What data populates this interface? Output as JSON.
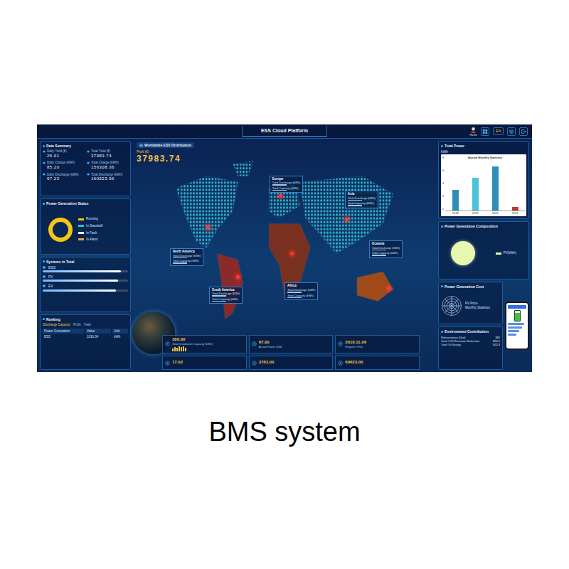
{
  "caption": "BMS system",
  "dashboard": {
    "title": "ESS Cloud Platform",
    "header": {
      "home": "Home",
      "language": "EN"
    },
    "data_summary": {
      "title": "Data Summary",
      "items": [
        {
          "label": "Daily Yield (€)",
          "value": "25.01"
        },
        {
          "label": "Total Yield (€)",
          "value": "37983.74"
        },
        {
          "label": "Daily Charge (kWh)",
          "value": "85.20"
        },
        {
          "label": "Total Charge (kWh)",
          "value": "156308.36"
        },
        {
          "label": "Daily Discharge (kWh)",
          "value": "67.23"
        },
        {
          "label": "Total Discharge (kWh)",
          "value": "160523.66"
        }
      ]
    },
    "status": {
      "title": "Power Generation Status",
      "legend": [
        {
          "label": "Running",
          "color": "#f5c518",
          "share": 1
        },
        {
          "label": "In Standstill",
          "color": "#22c1d6",
          "share": 0
        },
        {
          "label": "In Fault",
          "color": "#ffffff",
          "share": 0
        },
        {
          "label": "In Alarm",
          "color": "#e8a33a",
          "share": 0
        }
      ]
    },
    "systems": {
      "title": "Systems in Total",
      "items": [
        {
          "label": "ESS",
          "level": 0.92
        },
        {
          "label": "PV",
          "level": 0.88
        },
        {
          "label": "EV",
          "level": 0.86
        }
      ]
    },
    "ranking": {
      "title": "Ranking",
      "tabs": [
        {
          "label": "Discharge Capacity",
          "selected": true
        },
        {
          "label": "Profit",
          "selected": false
        },
        {
          "label": "Yield",
          "selected": false
        }
      ],
      "columns": [
        "Power Generation",
        "Value",
        "Unit"
      ],
      "rows": [
        [
          "ESS",
          "1016.34",
          "kWh"
        ]
      ]
    },
    "map": {
      "title": "Worldwide ESS Distribution",
      "profit_label": "Profit (€):",
      "profit": "37983.74",
      "regions": [
        {
          "name": "Europe",
          "lines": [
            "Total Discharge (kWh)",
            "Total Capacity (kWh)"
          ]
        },
        {
          "name": "Asia",
          "lines": [
            "Total Discharge (kWh)",
            "Total Capacity (kWh)"
          ]
        },
        {
          "name": "North America",
          "lines": [
            "Total Discharge (kWh)",
            "Total Capacity (kWh)"
          ]
        },
        {
          "name": "South America",
          "lines": [
            "Total Discharge (kWh)",
            "Total Capacity (kWh)"
          ]
        },
        {
          "name": "Africa",
          "lines": [
            "Total Discharge (kWh)",
            "Total Capacity (kWh)"
          ]
        },
        {
          "name": "Oceania",
          "lines": [
            "Total Discharge (kWh)",
            "Total Capacity (kWh)"
          ]
        }
      ]
    },
    "stats": [
      {
        "value": "300.00",
        "label": "Total Installation Capacity (kWh)"
      },
      {
        "value": "67.00",
        "label": "Actual Power (kW)"
      },
      {
        "value": "2019.11.06",
        "label": "Register Time"
      },
      {
        "value": "17.02",
        "label": ""
      },
      {
        "value": "3783.00",
        "label": ""
      },
      {
        "value": "69623.00",
        "label": ""
      }
    ],
    "total_power": {
      "title": "Total Power",
      "unit": "kWh",
      "chart_title": "Annual Monthly Statistics",
      "ticks": [
        "8",
        "6",
        "4",
        "2",
        "0"
      ],
      "years": [
        "2018",
        "2019",
        "2020",
        "2021"
      ],
      "values": [
        3.2,
        5.1,
        6.8,
        0.6
      ]
    },
    "generation": {
      "title": "Power Generation Composition",
      "legend": "PV(kWh)"
    },
    "cost": {
      "title": "Power Generation Cost",
      "legend": [
        "PV Price",
        "Monthly Statistics"
      ]
    },
    "environment": {
      "title": "Environment Contribution",
      "items": [
        {
          "label": "Reforestation (Unit)",
          "value": "382"
        },
        {
          "label": "Total CO2 Emission Reduction",
          "value": "892.1"
        },
        {
          "label": "Total Oil Saving",
          "value": "652.3"
        }
      ]
    }
  }
}
